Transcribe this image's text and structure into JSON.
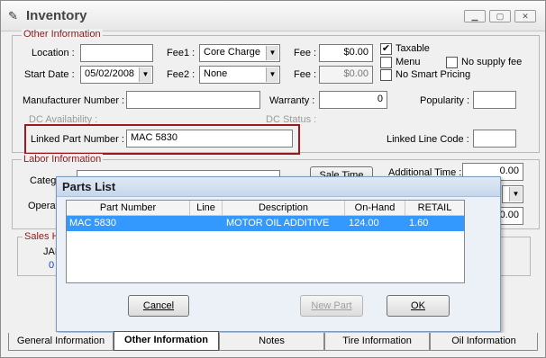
{
  "window": {
    "title": "Inventory",
    "min": "▁",
    "max": "▢",
    "close": "✕"
  },
  "other_info": {
    "legend": "Other Information",
    "location_label": "Location :",
    "location_value": "",
    "start_date_label": "Start Date :",
    "start_date_value": "05/02/2008",
    "fee1_label": "Fee1 :",
    "fee1_value": "Core Charge",
    "fee2_label": "Fee2 :",
    "fee2_value": "None",
    "fee_label_1": "Fee :",
    "fee_value_1": "$0.00",
    "fee_label_2": "Fee :",
    "fee_value_2": "$0.00",
    "taxable_label": "Taxable",
    "taxable_checked": true,
    "menu_label": "Menu",
    "no_supply_fee_label": "No supply fee",
    "no_smart_pricing_label": "No Smart Pricing",
    "manufacturer_label": "Manufacturer Number :",
    "manufacturer_value": "",
    "warranty_label": "Warranty :",
    "warranty_value": "0",
    "popularity_label": "Popularity :",
    "popularity_value": "",
    "dc_availability_label": "DC Availability :",
    "dc_status_label": "DC Status :",
    "linked_part_label": "Linked Part Number :",
    "linked_part_value": "MAC 5830",
    "linked_line_label": "Linked Line Code :",
    "linked_line_value": ""
  },
  "labor_info": {
    "legend": "Labor Information",
    "category_label": "Categ",
    "operation_label": "Operat",
    "sale_time_label": "Sale Time",
    "additional_time_label": "Additional Time :",
    "additional_time_value": "0.00",
    "amount_value": "$0.00"
  },
  "sales": {
    "legend": "Sales H",
    "line1": "JAN",
    "line2": "0"
  },
  "parts_dialog": {
    "title": "Parts List",
    "columns": [
      "Part Number",
      "Line",
      "Description",
      "On-Hand",
      "RETAIL"
    ],
    "rows": [
      {
        "part": "MAC 5830",
        "line": "",
        "desc": "MOTOR OIL ADDITIVE",
        "onhand": "124.00",
        "retail": "1.60"
      }
    ],
    "cancel": "Cancel",
    "new_part": "New Part",
    "ok": "OK"
  },
  "tabs": [
    "General Information",
    "Other Information",
    "Notes",
    "Tire Information",
    "Oil Information"
  ],
  "active_tab": "Other Information"
}
